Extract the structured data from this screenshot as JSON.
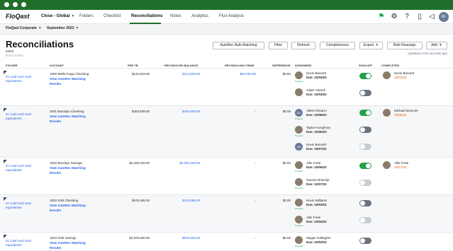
{
  "app": {
    "logo": "FloQast",
    "close_selector": "Close - Global",
    "nav": [
      "Folders",
      "Checklist",
      "Reconciliations",
      "Notes",
      "Analytics",
      "Flux Analysis"
    ],
    "active_nav": "Reconciliations",
    "user_initials": "RL"
  },
  "filters": {
    "entity": "FloQast Corporate",
    "period": "September 2023"
  },
  "page": {
    "title": "Reconciliations",
    "count": "83/83",
    "reset": "Reset Filters",
    "updated": "Updated a few seconds ago",
    "buttons": [
      "AutoRec Bulk Matching",
      "Filter",
      "Refresh",
      "Completeness",
      "Export",
      "Bulk Reassign",
      "Add"
    ]
  },
  "table": {
    "headers": [
      "FOLDER",
      "ACCOUNT",
      "PER TB",
      "RECONCILED BALANCE",
      "RECONCILING ITEMS",
      "DIFFERENCE",
      "ASSIGNEES",
      "SIGN-OFF",
      "COMPLETED"
    ],
    "rows": [
      {
        "folder": "01 Cash and cash equivalents",
        "account": "1000 Wells Fargo Checking",
        "link": "View AutoRec Matching",
        "link2": "Results",
        "per_tb": "$134,918.00",
        "reconciled": "$114,918.00",
        "reconciling_items": "$20,000.00",
        "difference": "$0.00",
        "assignees": [
          {
            "name": "Kevin Bennett",
            "due": "Due: 10/04/22",
            "role": "Preparer",
            "initials": "",
            "signed": true
          },
          {
            "name": "Adam Yarnell",
            "due": "Due: 10/04/22",
            "role": "",
            "initials": "",
            "signed": false
          }
        ],
        "completed": {
          "name": "Kevin Bennett",
          "date": "10/01/22"
        }
      },
      {
        "folder": "01 Cash and cash equivalents",
        "account": "1001 Barclays Checking",
        "link": "View AutoRec Matching",
        "link2": "Results",
        "per_tb": "$404,509.00",
        "reconciled": "$404,509.00",
        "reconciling_items": "-",
        "difference": "$0.00",
        "assignees": [
          {
            "name": "Albert Olivarro",
            "due": "Due: 10/06/22",
            "role": "Preparer",
            "initials": "AO",
            "signed": true
          },
          {
            "name": "Taylor Humphrey",
            "due": "Due: 10/06/22",
            "role": "Preparer",
            "initials": "",
            "signed": false
          },
          {
            "name": "Kevin Bennett",
            "due": "Due: 10/07/22",
            "role": "",
            "initials": "KB",
            "signed": false
          }
        ],
        "completed": {
          "name": "Michael McGuire",
          "date": "10/06/22"
        }
      },
      {
        "folder": "01 Cash and cash equivalents",
        "account": "1002 Barclays Savings",
        "link": "View AutoRec Matching",
        "link2": "Results",
        "per_tb": "$2,325,428.00",
        "reconciled": "$2,325,428.00",
        "reconciling_items": "-",
        "difference": "$0.00",
        "assignees": [
          {
            "name": "Allie Forte",
            "due": "Due: 10/06/22",
            "role": "Preparer",
            "initials": "",
            "signed": true
          },
          {
            "name": "Gaurav Dhamija",
            "due": "Due: 10/07/22",
            "role": "Preparer",
            "initials": "",
            "signed": false
          }
        ],
        "completed": {
          "name": "Allie Forte",
          "date": "10/17/22"
        }
      },
      {
        "folder": "01 Cash and cash equivalents",
        "account": "1003 SVB Checking",
        "link": "View AutoRec Matching",
        "link2": "Results",
        "per_tb": "$103,485.00",
        "reconciled": "$103,485.00",
        "reconciling_items": "-",
        "difference": "$0.00",
        "assignees": [
          {
            "name": "Kevin Williams",
            "due": "Due: 10/03/22",
            "role": "Preparer",
            "initials": "",
            "signed": false
          },
          {
            "name": "Allie Forte",
            "due": "Due: 10/04/22",
            "role": "Preparer",
            "initials": "",
            "signed": false
          }
        ],
        "completed": {
          "name": "",
          "date": ""
        }
      },
      {
        "folder": "01 Cash and cash equivalents",
        "account": "1004 SVB Savings",
        "link": "View AutoRec Matching",
        "link2": "Results",
        "per_tb": "$2,875,930.00",
        "reconciled": "$875,930.00",
        "reconciling_items": "-",
        "difference": "$0.00",
        "assignees": [
          {
            "name": "Megan Gallagher",
            "due": "Due: 10/03/22",
            "role": "Preparer",
            "initials": "",
            "signed": false
          }
        ],
        "completed": {
          "name": "",
          "date": ""
        }
      }
    ]
  }
}
